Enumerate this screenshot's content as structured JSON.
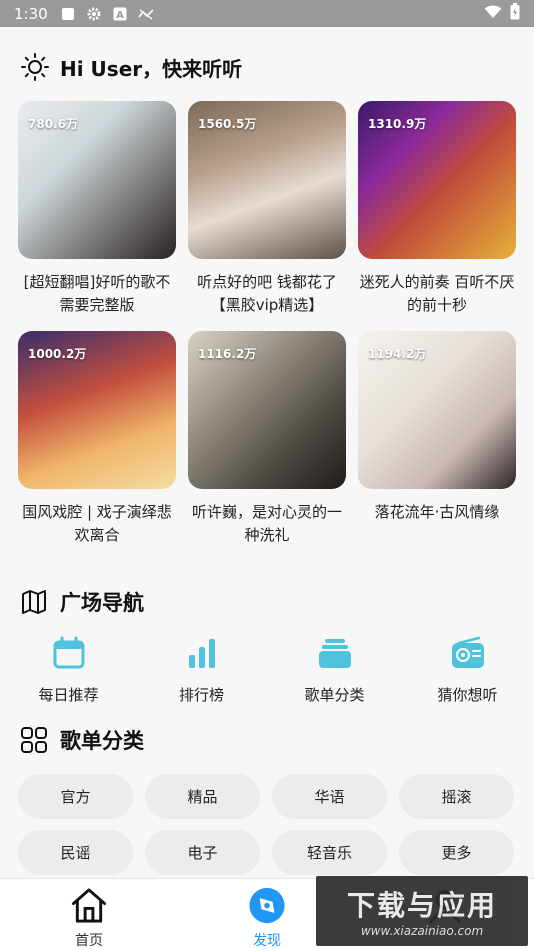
{
  "status_bar": {
    "time": "1:30",
    "icons": [
      "square-icon",
      "gear-icon",
      "a-icon",
      "signal-off-icon",
      "wifi-icon",
      "battery-icon"
    ]
  },
  "greeting": {
    "icon": "sun-icon",
    "text": "Hi User，快来听听"
  },
  "playlists": [
    {
      "count": "780.6万",
      "title": "[超短翻唱]好听的歌不需要完整版"
    },
    {
      "count": "1560.5万",
      "title": "听点好的吧 钱都花了【黑胶vip精选】"
    },
    {
      "count": "1310.9万",
      "title": "迷死人的前奏 百听不厌的前十秒"
    },
    {
      "count": "1000.2万",
      "title": "国风戏腔 | 戏子演绎悲欢离合"
    },
    {
      "count": "1116.2万",
      "title": "听许巍，是对心灵的一种洗礼"
    },
    {
      "count": "1194.2万",
      "title": "落花流年·古风情缘"
    }
  ],
  "plaza_nav": {
    "icon": "map-icon",
    "title": "广场导航",
    "items": [
      {
        "icon": "calendar-icon",
        "label": "每日推荐"
      },
      {
        "icon": "bar-chart-icon",
        "label": "排行榜"
      },
      {
        "icon": "stack-icon",
        "label": "歌单分类"
      },
      {
        "icon": "radio-icon",
        "label": "猜你想听"
      }
    ]
  },
  "categories": {
    "icon": "grid-icon",
    "title": "歌单分类",
    "items": [
      "官方",
      "精品",
      "华语",
      "摇滚",
      "民谣",
      "电子",
      "轻音乐",
      "更多"
    ]
  },
  "bottom_nav": {
    "tabs": [
      {
        "icon": "home-icon",
        "label": "首页",
        "active": false
      },
      {
        "icon": "discover-icon",
        "label": "发现",
        "active": true
      },
      {
        "icon": "profile-icon",
        "label": "",
        "active": false
      }
    ]
  },
  "watermark": {
    "title": "下载与应用",
    "url": "www.xiazainiao.com"
  },
  "colors": {
    "accent": "#2196f3",
    "icon_teal": "#4fc3dc",
    "chip_bg": "#ececec",
    "page_bg": "#f7f7f7"
  }
}
